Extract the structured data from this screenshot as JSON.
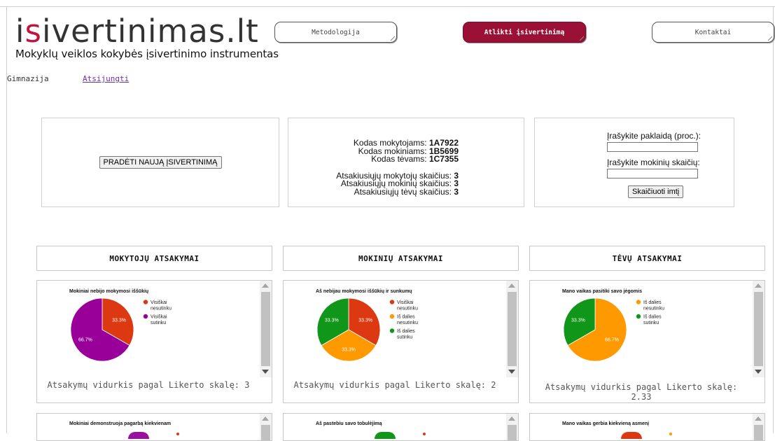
{
  "header": {
    "logo_pre": "i",
    "logo_accent": "s",
    "logo_rest": "ivertinimas.lt",
    "tagline": "Mokyklų veiklos kokybės įsivertinimo instrumentas",
    "nav": [
      "Metodologija",
      "Atlikti įsivertinimą",
      "Kontaktai"
    ]
  },
  "user": {
    "role": "Gimnazija",
    "logout": "Atsijungti"
  },
  "start_panel": {
    "button": "PRADĖTI NAUJĄ ĮSIVERTINIMĄ"
  },
  "codes": {
    "teacher_label": "Kodas mokytojams:",
    "teacher_code": "1A7922",
    "student_label": "Kodas mokiniams:",
    "student_code": "1B5699",
    "parent_label": "Kodas tėvams:",
    "parent_code": "1C7355",
    "teacher_count_label": "Atsakiusiųjų mokytojų skaičius:",
    "teacher_count": "3",
    "student_count_label": "Atsakiusiųjų mokinių skaičius:",
    "student_count": "3",
    "parent_count_label": "Atsakiusiųjų tėvų skaičius:",
    "parent_count": "3"
  },
  "calculator": {
    "error_label": "Įrašykite paklaidą (proc.):",
    "students_label": "Įrašykite mokinių skaičių:",
    "button": "Skaičiuoti imtį"
  },
  "sections": [
    "MOKYTOJŲ ATSAKYMAI",
    "MOKINIŲ ATSAKYMAI",
    "TĖVŲ ATSAKYMAI"
  ],
  "colors": {
    "brand": "#9b1035",
    "visiskai_nesutinku": "#dc3912",
    "is_dalies_nesutinku": "#ff9900",
    "is_dalies_sutinku": "#109618",
    "visiskai_sutinku": "#990099"
  },
  "cards": [
    {
      "avg": "Atsakymų vidurkis pagal Likerto skalę: 3"
    },
    {
      "avg": "Atsakymų vidurkis pagal Likerto skalę: 2"
    },
    {
      "avg": "Atsakymų vidurkis pagal Likerto skalę: 2.33"
    }
  ],
  "chart_data": [
    {
      "type": "pie",
      "title": "Mokiniai nebijo mokymosi iššūkių",
      "slices": [
        {
          "label": "Visiškai nesutinku",
          "value": 33.3,
          "color": "#dc3912"
        },
        {
          "label": "Visiškai sutinku",
          "value": 66.7,
          "color": "#990099"
        }
      ]
    },
    {
      "type": "pie",
      "title": "Aš nebijau mokymosi iššūkių ir sunkumų",
      "slices": [
        {
          "label": "Visiškai nesutinku",
          "value": 33.3,
          "color": "#dc3912"
        },
        {
          "label": "Iš dalies nesutinku",
          "value": 33.3,
          "color": "#ff9900"
        },
        {
          "label": "Iš dalies sutinku",
          "value": 33.3,
          "color": "#109618"
        }
      ]
    },
    {
      "type": "pie",
      "title": "Mano vaikas pasitiki savo jėgomis",
      "slices": [
        {
          "label": "Iš dalies nesutinku",
          "value": 66.7,
          "color": "#ff9900"
        },
        {
          "label": "Iš dalies sutinku",
          "value": 33.3,
          "color": "#109618"
        }
      ]
    }
  ],
  "next_cards": [
    {
      "title": "Mokiniai demonstruoja pagarbą kiekvienam"
    },
    {
      "title": "Aš pastebiu savo tobulėjimą"
    },
    {
      "title": "Mano vaikas gerbia kiekvieną asmenį"
    }
  ]
}
